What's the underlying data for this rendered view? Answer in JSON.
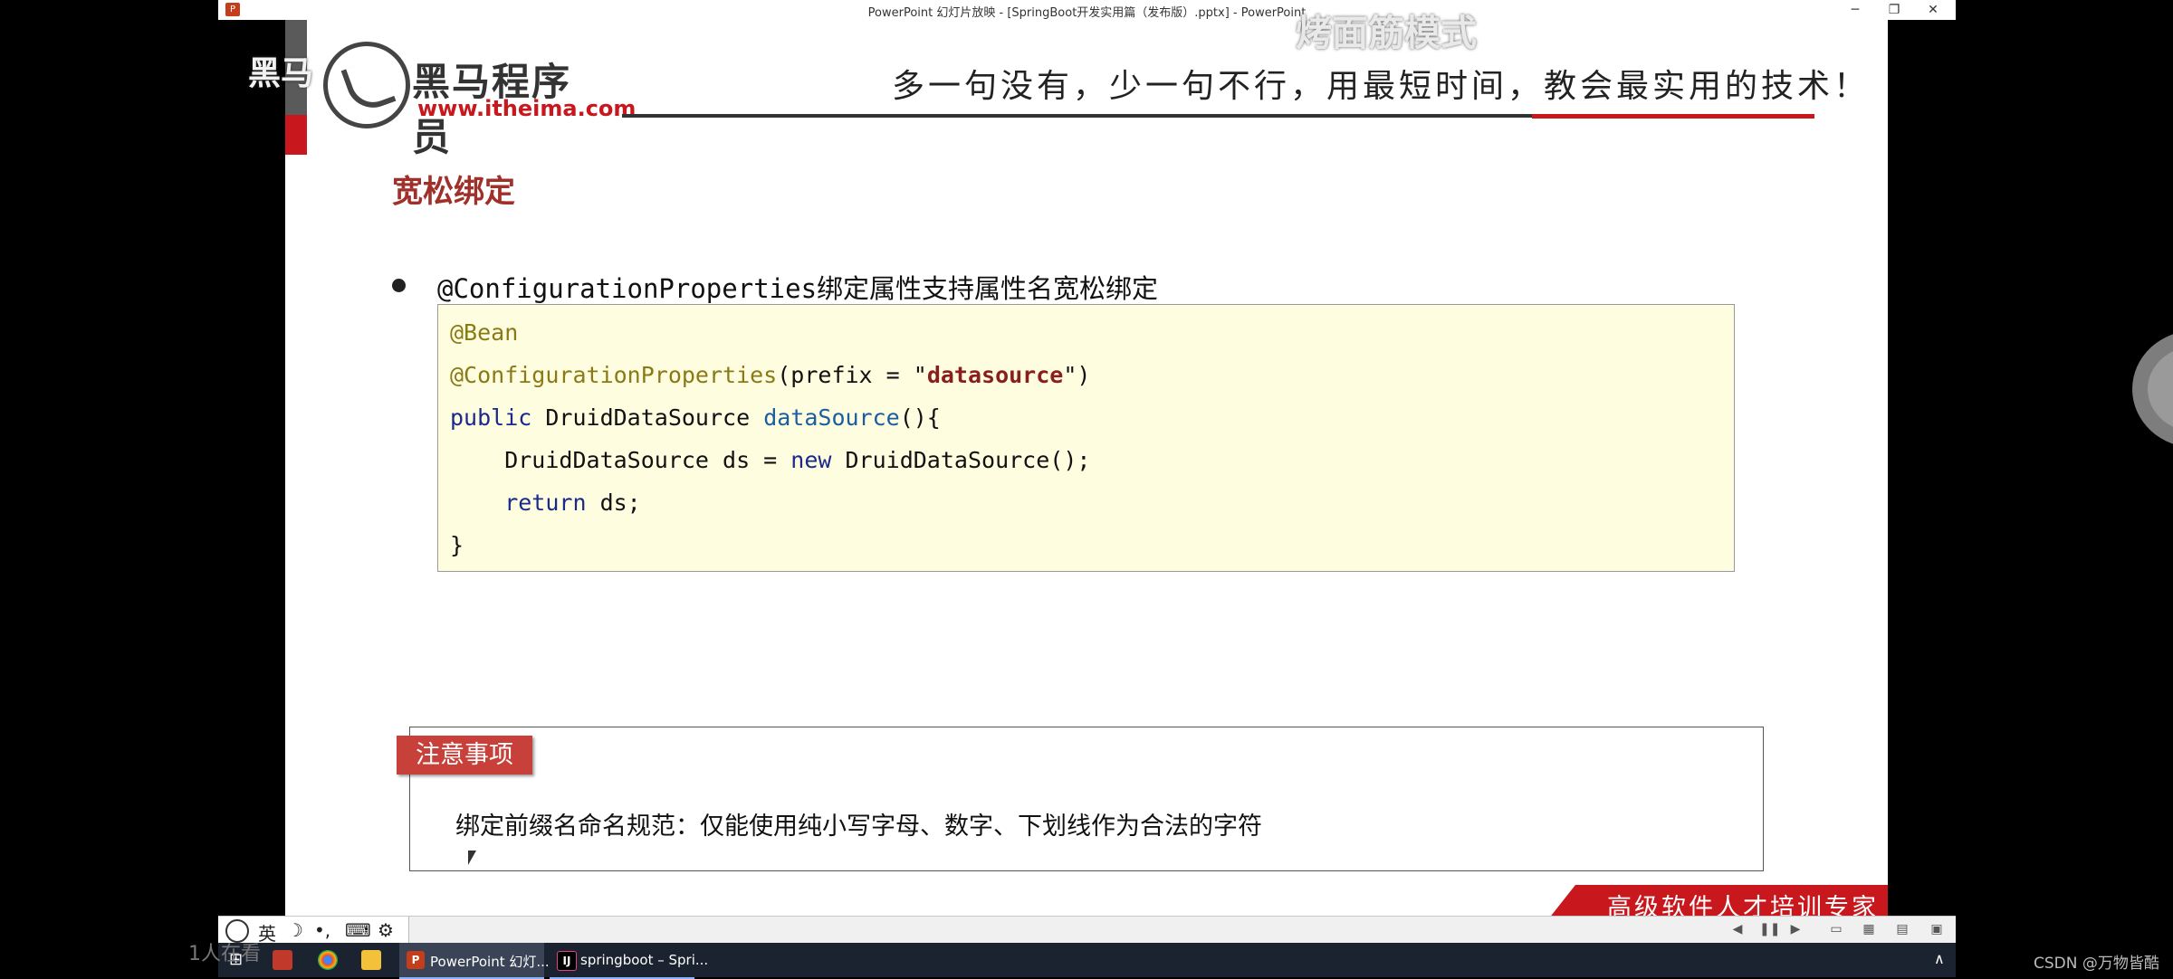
{
  "window": {
    "title": "PowerPoint 幻灯片放映 - [SpringBoot开发实用篇（发布版）.pptx] - PowerPoint",
    "minimize_glyph": "─",
    "restore_glyph": "❐",
    "close_glyph": "✕"
  },
  "overlay": {
    "mode_text": "烤面筋模式",
    "left_text": "黑马"
  },
  "slide": {
    "logo_cn": "黑马程序员",
    "logo_url": "www.itheima.com",
    "slogan": "多一句没有，少一句不行，用最短时间，教会最实用的技术！",
    "title": "宽松绑定",
    "bullet_code": "@ConfigurationProperties",
    "bullet_text": "绑定属性支持属性名宽松绑定",
    "code": {
      "line1": "@Bean",
      "line2_ann": "@ConfigurationProperties",
      "line2_a": "(prefix = \"",
      "line2_str": "datasource",
      "line2_b": "\")",
      "line3_kw": "public",
      "line3_a": " DruidDataSource ",
      "line3_fn": "dataSource",
      "line3_b": "(){",
      "line4_a": "    DruidDataSource ds = ",
      "line4_kw": "new",
      "line4_b": " DruidDataSource();",
      "line5_kw": "    return",
      "line5_b": " ds;",
      "line6": "}"
    },
    "note_tag": "注意事项",
    "note_text": "绑定前缀名命名规范：仅能使用纯小写字母、数字、下划线作为合法的字符",
    "footer": "高级软件人才培训专家"
  },
  "ime": {
    "lang": "英",
    "moon": "☽",
    "punct": "•,",
    "keyboard": "⌨",
    "gear": "⚙"
  },
  "taskbar": {
    "apps": [
      {
        "label": "PowerPoint 幻灯..."
      },
      {
        "label": "springboot – Spri..."
      }
    ],
    "watch_text": "1人在看",
    "caret": "∧"
  },
  "watermark": "CSDN @万物皆酷",
  "colors": {
    "brand_red": "#c8181d",
    "title_red": "#a0302a",
    "code_bg": "#fefde0",
    "taskbar": "#1c2330"
  }
}
